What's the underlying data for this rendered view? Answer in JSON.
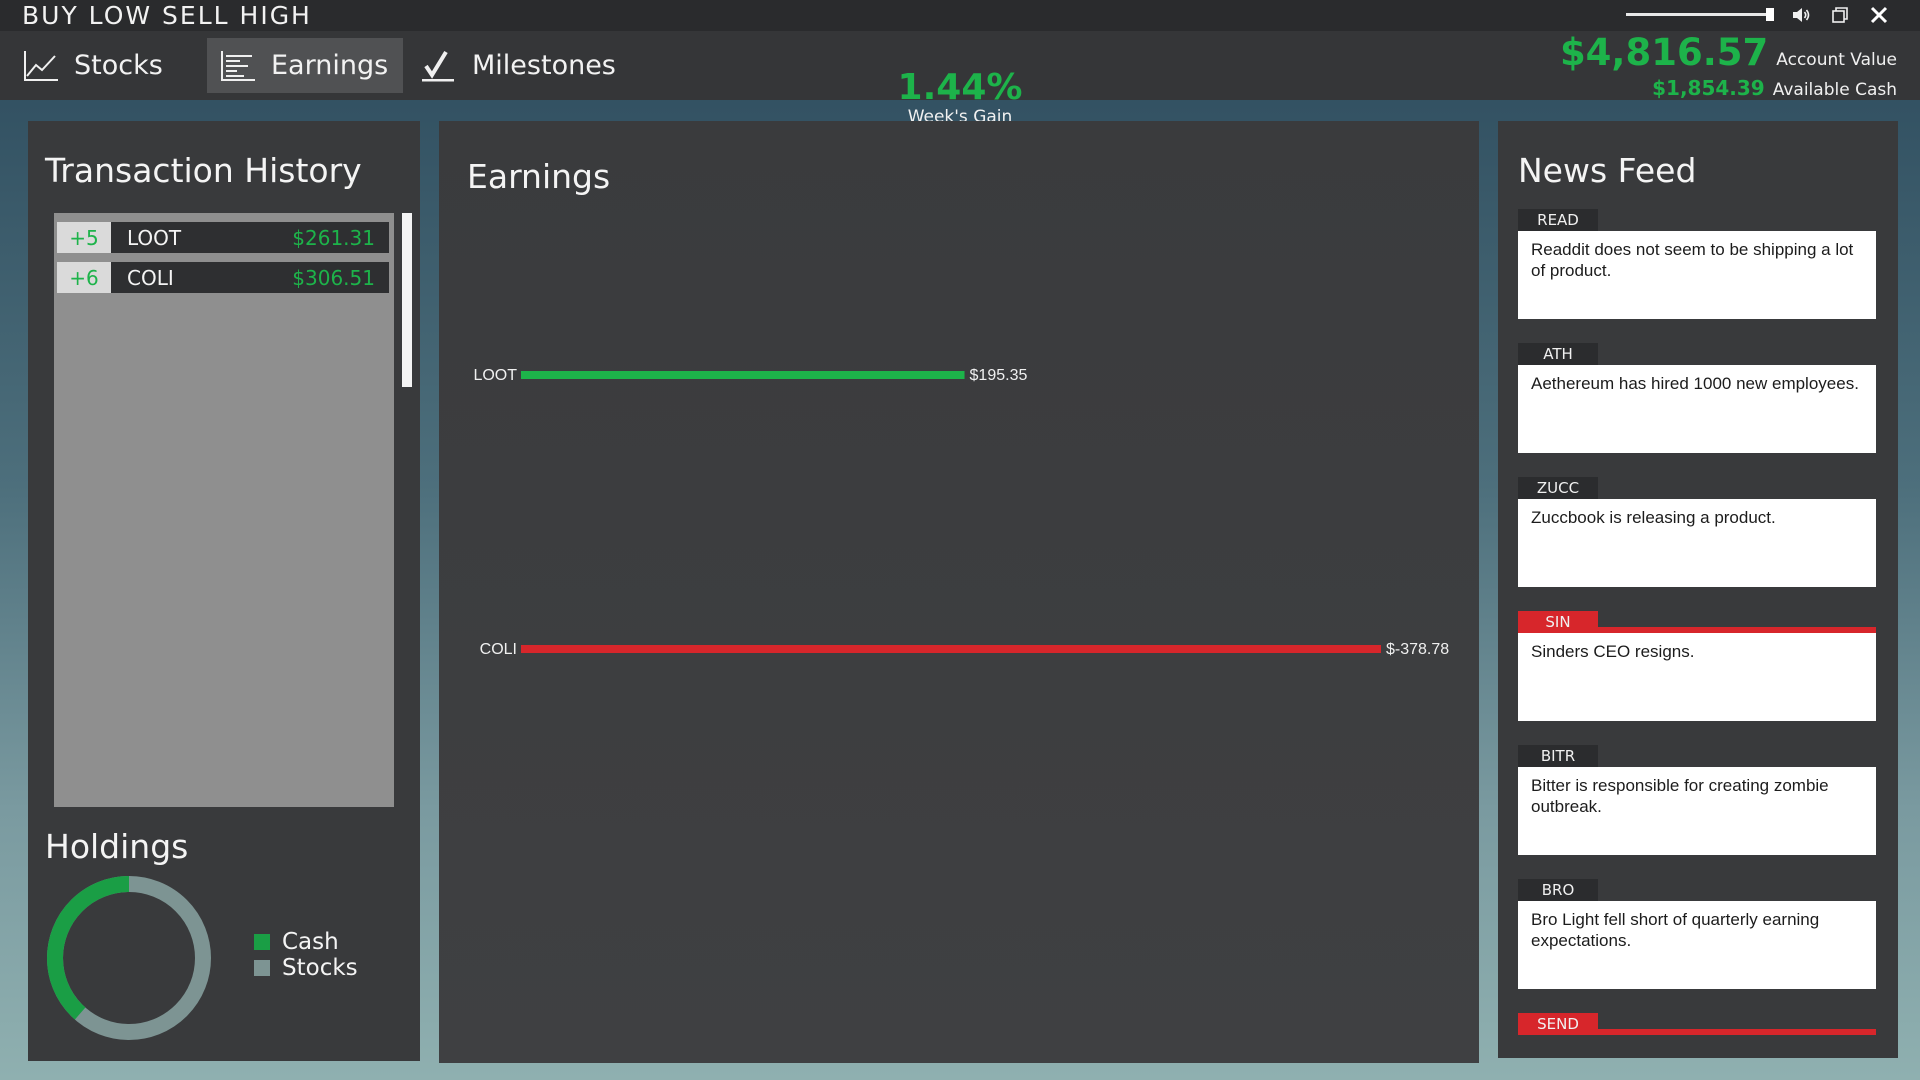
{
  "app": {
    "title": "BUY LOW SELL HIGH"
  },
  "nav": {
    "tabs": [
      {
        "label": "Stocks",
        "icon": "line-chart-icon",
        "active": false
      },
      {
        "label": "Earnings",
        "icon": "bar-list-icon",
        "active": true
      },
      {
        "label": "Milestones",
        "icon": "checkmark-icon",
        "active": false
      }
    ]
  },
  "stats": {
    "weeks_gain": "1.44%",
    "weeks_gain_label": "Week's Gain",
    "account_value": "$4,816.57",
    "account_value_label": "Account Value",
    "available_cash": "$1,854.39",
    "available_cash_label": "Available Cash"
  },
  "volume": {
    "level": 1.0
  },
  "transaction_history": {
    "heading": "Transaction History",
    "rows": [
      {
        "qty": "+5",
        "symbol": "LOOT",
        "amount": "$261.31"
      },
      {
        "qty": "+6",
        "symbol": "COLI",
        "amount": "$306.51"
      }
    ]
  },
  "holdings": {
    "heading": "Holdings",
    "legend": [
      {
        "label": "Cash",
        "color": "#1a9e45"
      },
      {
        "label": "Stocks",
        "color": "#7d9493"
      }
    ],
    "cash_fraction": 0.385
  },
  "earnings": {
    "heading": "Earnings"
  },
  "chart_data": {
    "type": "bar",
    "orientation": "horizontal",
    "title": "Earnings",
    "categories": [
      "LOOT",
      "COLI"
    ],
    "values": [
      195.35,
      -378.78
    ],
    "value_labels": [
      "$195.35",
      "$-378.78"
    ],
    "colors": {
      "positive": "#1db34a",
      "negative": "#d7262b"
    },
    "xlabel": "",
    "ylabel": "",
    "grid": false
  },
  "news_feed": {
    "heading": "News Feed",
    "items": [
      {
        "symbol": "READ",
        "text": "Readdit does not seem to be shipping a lot of product.",
        "alert": false
      },
      {
        "symbol": "ATH",
        "text": "Aethereum has hired 1000 new employees.",
        "alert": false
      },
      {
        "symbol": "ZUCC",
        "text": "Zuccbook is releasing a product.",
        "alert": false
      },
      {
        "symbol": "SIN",
        "text": "Sinders CEO resigns.",
        "alert": true
      },
      {
        "symbol": "BITR",
        "text": "Bitter is responsible for creating zombie outbreak.",
        "alert": false
      },
      {
        "symbol": "BRO",
        "text": "Bro Light fell short of quarterly earning expectations.",
        "alert": false
      },
      {
        "symbol": "SEND",
        "text": "",
        "alert": true
      }
    ]
  }
}
